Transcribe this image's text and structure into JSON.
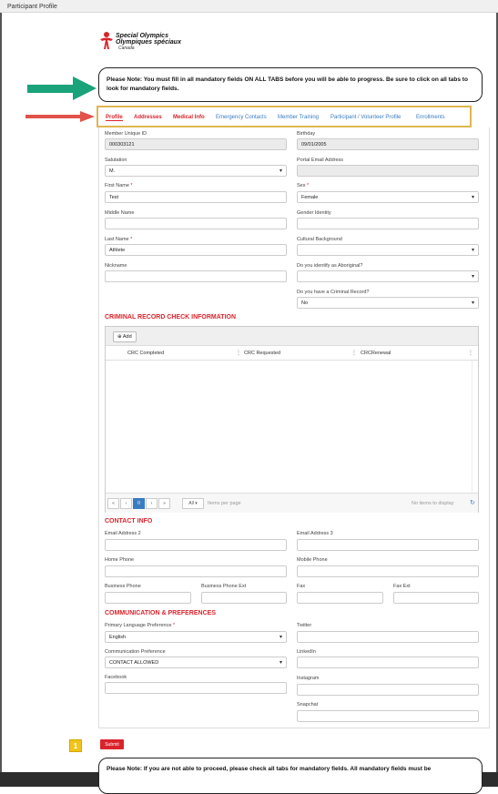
{
  "window": {
    "title": "Participant Profile"
  },
  "logo": {
    "line1": "Special Olympics",
    "line2": "Olympiques spéciaux",
    "line3": "Canada"
  },
  "notice_top": "Please Note: You must fill in all mandatory fields ON ALL TABS before you will be able to progress. Be sure to click on all tabs to look for mandatory fields.",
  "notice_bottom": "Please Note: If you are not able to proceed, please check all tabs for mandatory fields. All mandatory fields must be",
  "tabs": [
    {
      "label": "Profile"
    },
    {
      "label": "Addresses"
    },
    {
      "label": "Medical Info"
    },
    {
      "label": "Emergency Contacts"
    },
    {
      "label": "Member Training"
    },
    {
      "label": "Participant / Volunteer Profile"
    },
    {
      "label": "Enrollments"
    }
  ],
  "profile": {
    "member_id_label": "Member Unique ID",
    "member_id_value": "000303121",
    "birthday_label": "Birthday",
    "birthday_value": "09/01/2005",
    "salutation_label": "Salutation",
    "salutation_value": "M.",
    "portal_email_label": "Portal Email Address",
    "first_name_label": "First Name",
    "first_name_value": "Test",
    "sex_label": "Sex",
    "sex_value": "Female",
    "middle_name_label": "Middle Name",
    "gender_identity_label": "Gender Identity",
    "last_name_label": "Last Name",
    "last_name_value": "Athlete",
    "cultural_background_label": "Cultural Background",
    "nickname_label": "Nickname",
    "aboriginal_label": "Do you identify as Aboriginal?",
    "criminal_record_label": "Do you have a Criminal Record?",
    "criminal_record_value": "No",
    "required_mark": "*"
  },
  "crc": {
    "title": "CRIMINAL RECORD CHECK INFORMATION",
    "add_label": "Add",
    "columns": [
      "CRC Completed",
      "CRC Requested",
      "CRCRenewal"
    ],
    "page_current": "0",
    "page_size": "All",
    "items_per_page": "Items per page",
    "no_items": "No items to display"
  },
  "contact": {
    "title": "CONTACT INFO",
    "email2": "Email Address 2",
    "email3": "Email Address 3",
    "home_phone": "Home Phone",
    "mobile_phone": "Mobile Phone",
    "business_phone": "Business Phone",
    "business_phone_ext": "Business Phone Ext",
    "fax": "Fax",
    "fax_ext": "Fax Ext"
  },
  "comms": {
    "title": "COMMUNICATION & PREFERENCES",
    "primary_language_label": "Primary Language Preference",
    "primary_language_value": "English",
    "comm_pref_label": "Communication Preference",
    "comm_pref_value": "CONTACT ALLOWED",
    "facebook": "Facebook",
    "twitter": "Twitter",
    "linkedin": "LinkedIn",
    "instagram": "Instagram",
    "snapchat": "Snapchat"
  },
  "submit_label": "Submit",
  "step_badge": "1",
  "colors": {
    "accent_red": "#d9242b",
    "link_blue": "#3a7cc0",
    "highlight_gold": "#e0b650",
    "arrow_green": "#1aa37a"
  }
}
